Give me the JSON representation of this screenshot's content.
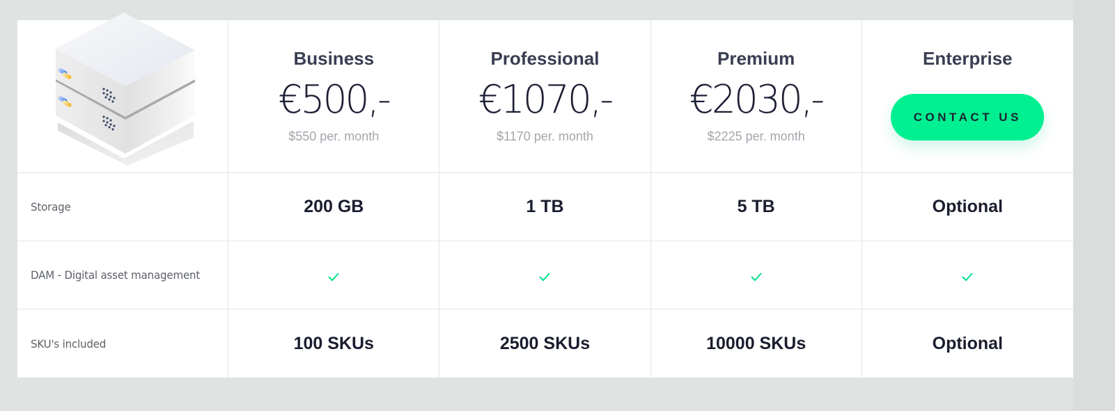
{
  "illustration": {
    "icon": "server-stack-icon"
  },
  "plans": [
    {
      "name": "Business",
      "price": "€500,-",
      "subprice": "$550 per. month"
    },
    {
      "name": "Professional",
      "price": "€1070,-",
      "subprice": "$1170 per. month"
    },
    {
      "name": "Premium",
      "price": "€2030,-",
      "subprice": "$2225 per. month"
    },
    {
      "name": "Enterprise",
      "cta_label": "CONTACT US"
    }
  ],
  "features": [
    {
      "label": "Storage",
      "values": [
        "200 GB",
        "1 TB",
        "5 TB",
        "Optional"
      ]
    },
    {
      "label": "DAM - Digital asset management",
      "values": [
        "check",
        "check",
        "check",
        "check"
      ]
    },
    {
      "label": "SKU's included",
      "values": [
        "100 SKUs",
        "2500 SKUs",
        "10000 SKUs",
        "Optional"
      ]
    }
  ],
  "colors": {
    "accent": "#00f091",
    "check": "#00e08a",
    "page_background": "#dfe3e2",
    "heading": "#3a3e52",
    "value_text": "#1a1d2e",
    "muted_text": "#a3a6ad"
  }
}
